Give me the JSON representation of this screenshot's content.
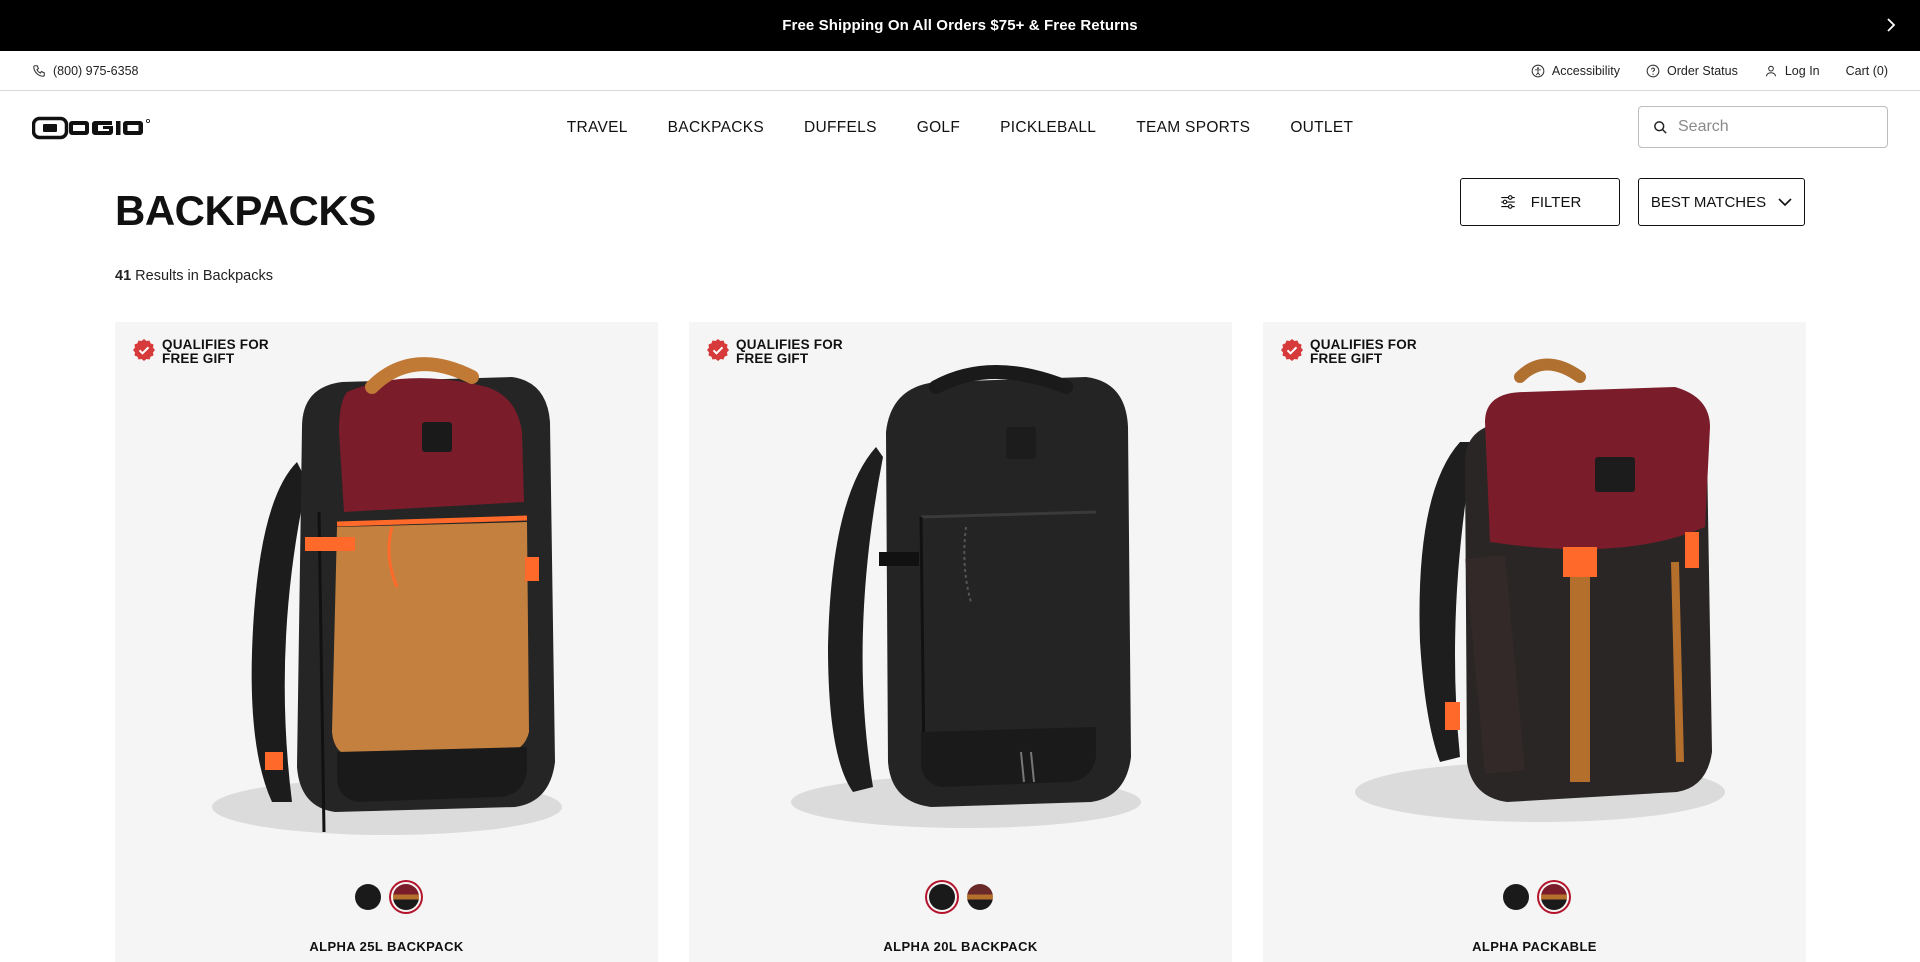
{
  "promo": {
    "text": "Free Shipping On All Orders $75+ & Free Returns",
    "arrow_icon": "chevron-right-icon"
  },
  "utility": {
    "phone": "(800) 975-6358",
    "accessibility": "Accessibility",
    "order_status": "Order Status",
    "login": "Log In",
    "cart": "Cart (0)"
  },
  "header": {
    "logo_text": "OGIO",
    "nav": [
      "TRAVEL",
      "BACKPACKS",
      "DUFFELS",
      "GOLF",
      "PICKLEBALL",
      "TEAM SPORTS",
      "OUTLET"
    ],
    "search_placeholder": "Search"
  },
  "page": {
    "title": "BACKPACKS",
    "filter_label": "FILTER",
    "sort_label": "BEST MATCHES",
    "results_count": "41",
    "results_text": " Results in ",
    "results_category": "Backpacks"
  },
  "products": [
    {
      "badge_line1": "QUALIFIES FOR",
      "badge_line2": "FREE GIFT",
      "name": "ALPHA 25L BACKPACK",
      "swatches": [
        {
          "color": "#1a1a1a",
          "selected": false
        },
        {
          "color": "#7a1c2a",
          "selected": true
        }
      ]
    },
    {
      "badge_line1": "QUALIFIES FOR",
      "badge_line2": "FREE GIFT",
      "name": "ALPHA 20L BACKPACK",
      "swatches": [
        {
          "color": "#1a1a1a",
          "selected": true
        },
        {
          "color": "#6b2a2a",
          "selected": false
        }
      ]
    },
    {
      "badge_line1": "QUALIFIES FOR",
      "badge_line2": "FREE GIFT",
      "name": "ALPHA PACKABLE",
      "swatches": [
        {
          "color": "#1a1a1a",
          "selected": false
        },
        {
          "color": "#7a1c2a",
          "selected": true
        }
      ]
    }
  ],
  "colors": {
    "promo_bg": "#000000",
    "badge_red": "#d63a3a",
    "card_bg": "#f5f5f5",
    "selected_ring": "#b3142b"
  }
}
